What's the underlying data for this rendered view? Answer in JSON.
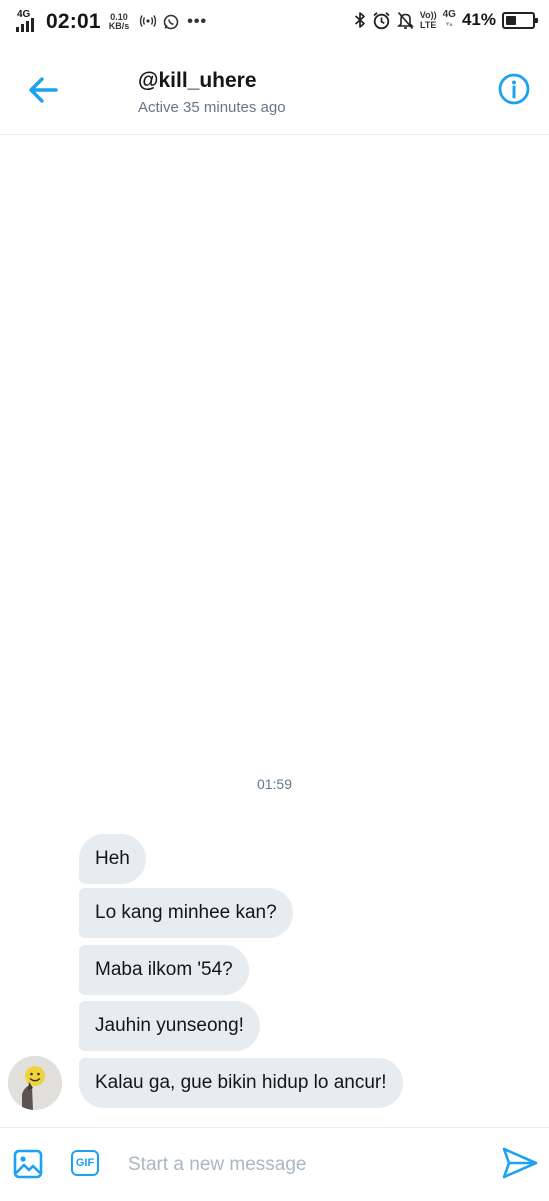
{
  "status_bar": {
    "network_label": "4G",
    "time": "02:01",
    "speed_value": "0.10",
    "speed_unit": "KB/s",
    "volte_top": "Vo))",
    "volte_bottom": "LTE",
    "network_right": "4G",
    "battery_percent": "41%",
    "battery_level": 0.41,
    "icons": [
      "signal-icon",
      "hotspot-icon",
      "whatsapp-icon",
      "more-dots-icon",
      "bluetooth-icon",
      "alarm-icon",
      "mute-icon",
      "battery-icon"
    ]
  },
  "header": {
    "title": "@kill_uhere",
    "subtitle": "Active 35 minutes ago",
    "back_icon": "arrow-left-icon",
    "info_icon": "info-icon"
  },
  "conversation": {
    "timestamp": "01:59",
    "messages": [
      {
        "text": "Heh"
      },
      {
        "text": "Lo kang minhee kan?"
      },
      {
        "text": "Maba ilkom '54?"
      },
      {
        "text": "Jauhin yunseong!"
      },
      {
        "text": "Kalau ga, gue bikin hidup lo ancur!"
      }
    ]
  },
  "composer": {
    "placeholder": "Start a new message",
    "value": "",
    "gif_label": "GIF",
    "media_icon": "image-icon",
    "send_icon": "send-icon"
  },
  "colors": {
    "accent": "#1da1f2",
    "bubble_bg": "#e6ecf0",
    "muted_text": "#657786",
    "placeholder": "#aab8c2"
  }
}
